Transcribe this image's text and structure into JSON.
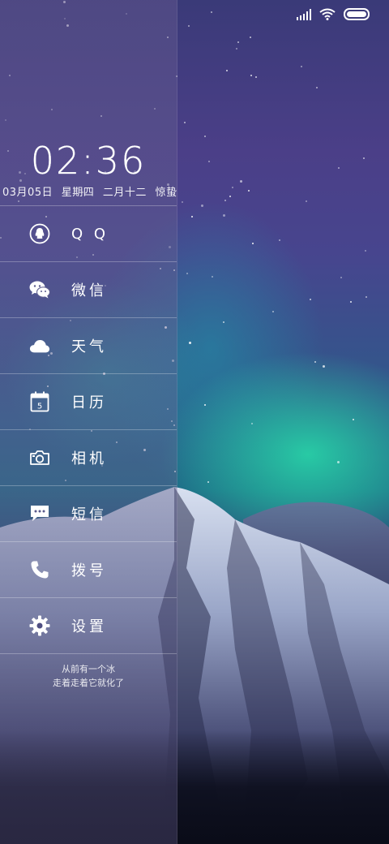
{
  "status_bar": {
    "signal_icon": "signal-icon",
    "wifi_icon": "wifi-icon",
    "battery_icon": "battery-icon"
  },
  "clock": {
    "time": "02:36",
    "date": "03月05日",
    "weekday": "星期四",
    "lunar_date": "二月十二",
    "solar_term": "惊蛰"
  },
  "menu": {
    "items": [
      {
        "label": "Q Q",
        "icon": "qq-icon"
      },
      {
        "label": "微信",
        "icon": "wechat-icon"
      },
      {
        "label": "天气",
        "icon": "cloud-icon"
      },
      {
        "label": "日历",
        "icon": "calendar-icon",
        "icon_text": "5"
      },
      {
        "label": "相机",
        "icon": "camera-icon"
      },
      {
        "label": "短信",
        "icon": "message-icon"
      },
      {
        "label": "拨号",
        "icon": "phone-icon"
      },
      {
        "label": "设置",
        "icon": "gear-icon"
      }
    ]
  },
  "signature": {
    "line1": "从前有一个冰",
    "line2": "走着走着它就化了"
  }
}
